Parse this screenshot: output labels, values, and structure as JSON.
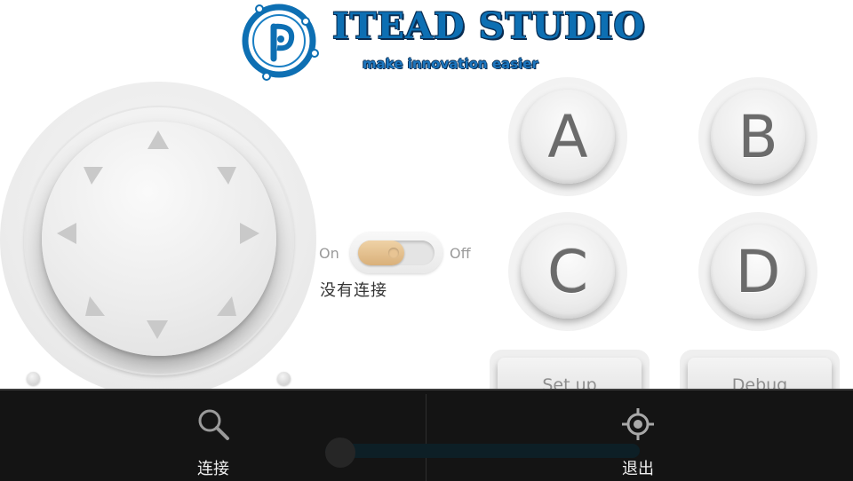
{
  "logo": {
    "title": "ITEAD STUDIO",
    "tagline": "make innovation easier",
    "mark_icon": "itead-logo-mark"
  },
  "joystick": {
    "arrows": [
      "up",
      "up-right",
      "right",
      "down-right",
      "down",
      "down-left",
      "left",
      "up-left"
    ]
  },
  "toggle": {
    "on_label": "On",
    "off_label": "Off",
    "state": "On"
  },
  "status_text": "没有连接",
  "buttons": {
    "a": "A",
    "b": "B",
    "c": "C",
    "d": "D",
    "setup": "Set up",
    "debug": "Debug"
  },
  "bottom_bar": {
    "connect_label": "连接",
    "connect_icon": "search-icon",
    "exit_label": "退出",
    "exit_icon": "crosshair-icon"
  },
  "colors": {
    "brand_blue": "#0d6fb3",
    "toggle_thumb": "#d9b07a",
    "bottom_bar": "#141414"
  }
}
